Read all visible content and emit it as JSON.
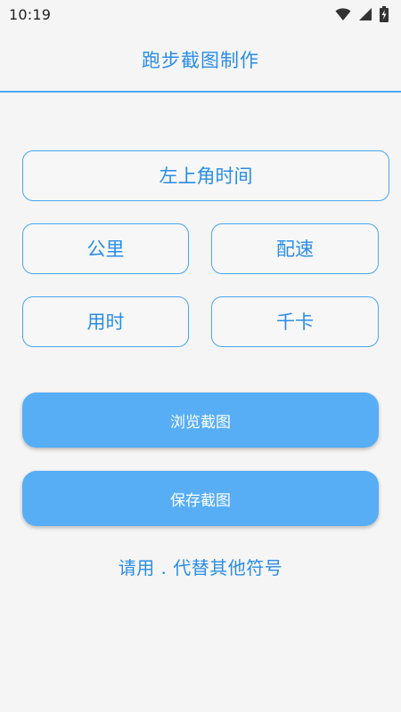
{
  "status_bar": {
    "time": "10:19",
    "icons": [
      "wifi-icon",
      "signal-icon",
      "battery-charging-icon"
    ]
  },
  "header": {
    "title": "跑步截图制作"
  },
  "fields": {
    "clock_placeholder": "左上角时间",
    "distance_placeholder": "公里",
    "pace_placeholder": "配速",
    "duration_placeholder": "用时",
    "calories_placeholder": "千卡"
  },
  "actions": {
    "preview_label": "浏览截图",
    "save_label": "保存截图"
  },
  "hint": "请用 . 代替其他符号",
  "colors": {
    "accent": "#2a8de6",
    "border": "#4aa6f0",
    "button": "#57aef5",
    "background": "#f5f5f5"
  }
}
